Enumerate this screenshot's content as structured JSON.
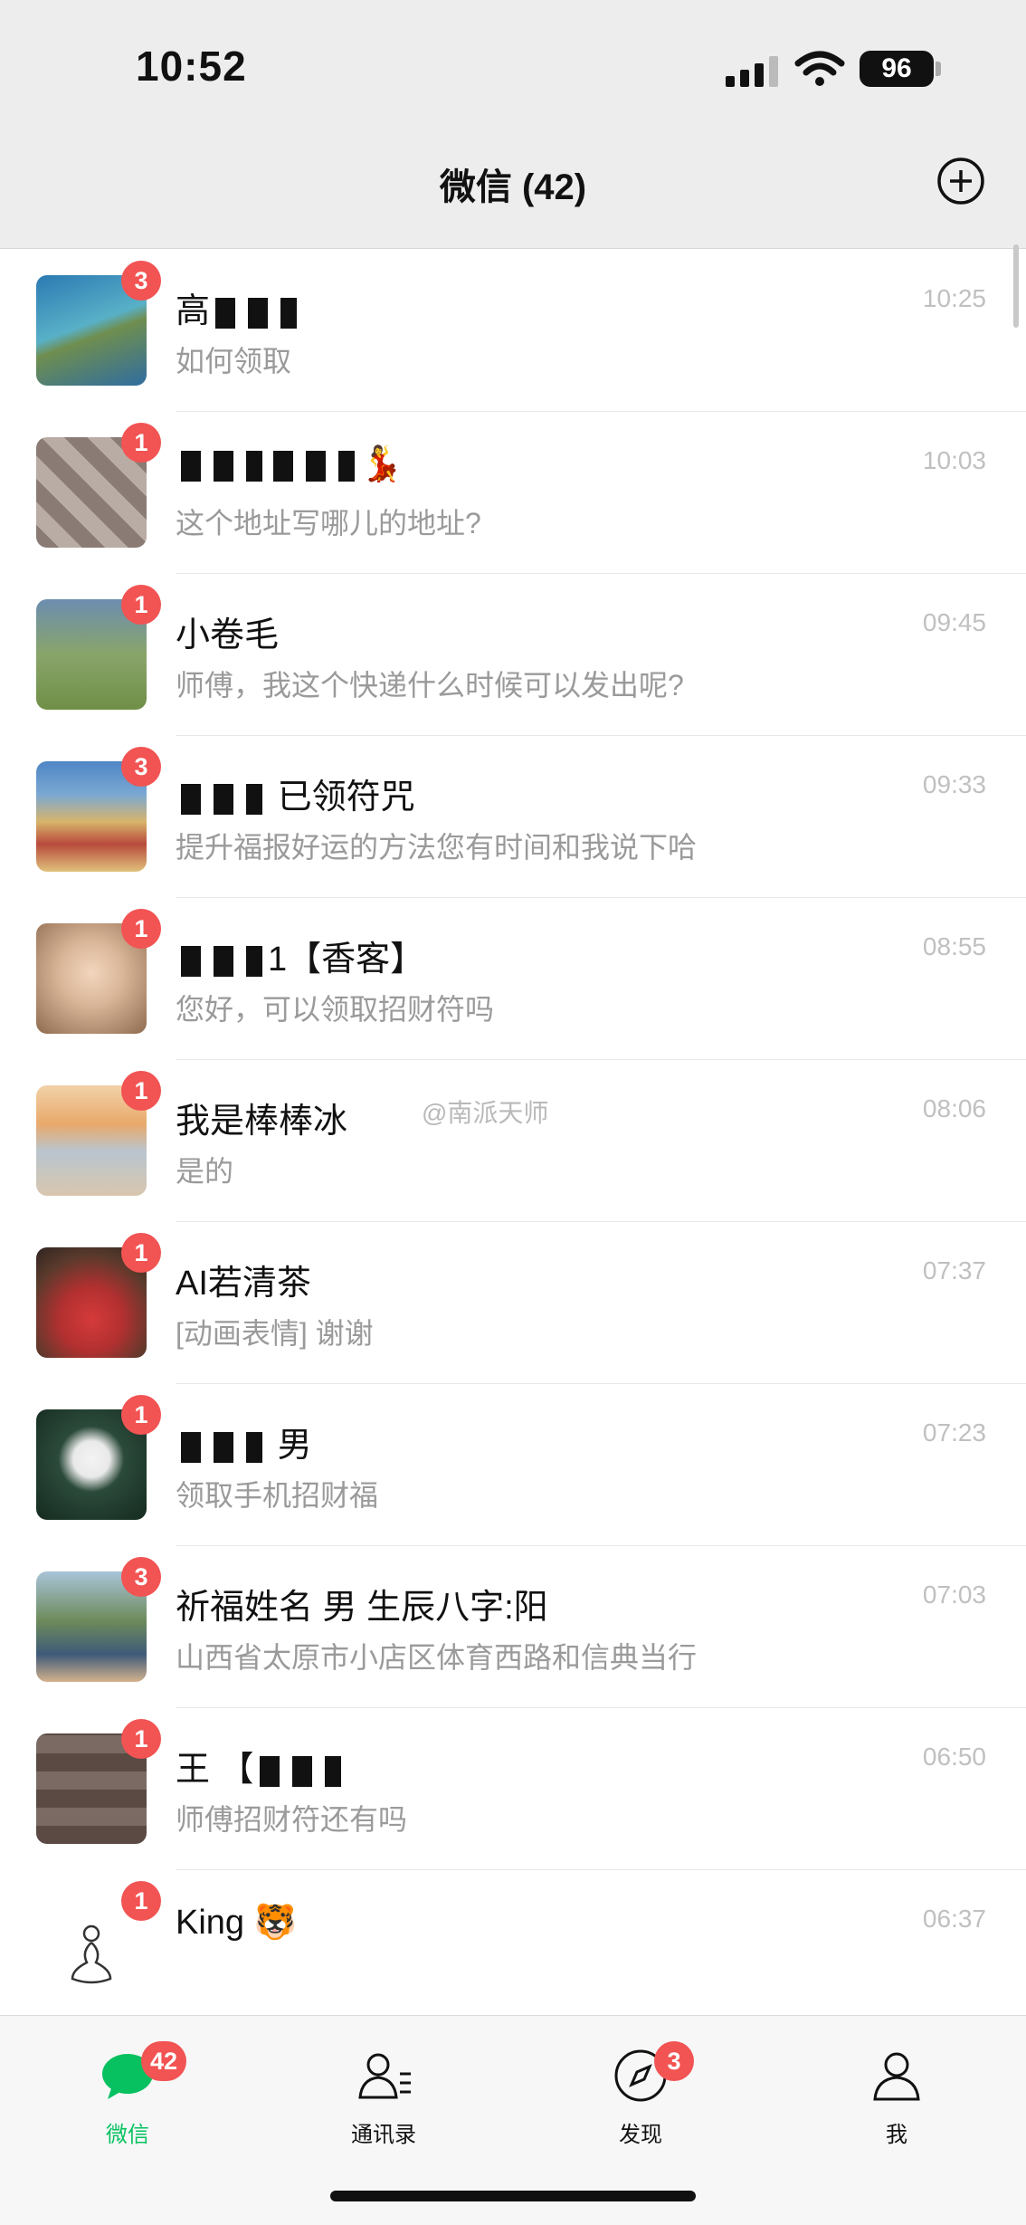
{
  "status_bar": {
    "time": "10:52",
    "battery": "96"
  },
  "nav": {
    "title": "微信 (42)"
  },
  "watermark": "@南派天师",
  "chats": [
    {
      "name": "高",
      "preview": "如何领取",
      "time": "10:25",
      "badge": "3",
      "avatar_color": "#3a8fb3"
    },
    {
      "name": "",
      "preview": "这个地址写哪儿的地址?",
      "time": "10:03",
      "badge": "1",
      "avatar_color": "#8a7c75"
    },
    {
      "name": "小卷毛",
      "preview": "师傅，我这个快递什么时候可以发出呢?",
      "time": "09:45",
      "badge": "1",
      "avatar_color": "#7d9a5d"
    },
    {
      "name": "已领符咒",
      "preview": "提升福报好运的方法您有时间和我说下哈",
      "time": "09:33",
      "badge": "3",
      "avatar_color": "#c89a56"
    },
    {
      "name": "1【香客】",
      "preview": "您好，可以领取招财符吗",
      "time": "08:55",
      "badge": "1",
      "avatar_color": "#d9b598"
    },
    {
      "name": "我是棒棒冰",
      "preview": "是的",
      "time": "08:06",
      "badge": "1",
      "avatar_color": "#e5c7a8"
    },
    {
      "name": "AI若清茶",
      "preview": "[动画表情] 谢谢",
      "time": "07:37",
      "badge": "1",
      "avatar_color": "#c73b3b"
    },
    {
      "name": "男",
      "preview": "领取手机招财福",
      "time": "07:23",
      "badge": "1",
      "avatar_color": "#2b4a3a"
    },
    {
      "name": "祈福姓名 男 生辰八字:阳",
      "preview": "山西省太原市小店区体育西路和信典当行",
      "time": "07:03",
      "badge": "3",
      "avatar_color": "#6d8a5b"
    },
    {
      "name": "王 【",
      "preview": "师傅招财符还有吗",
      "time": "06:50",
      "badge": "1",
      "avatar_color": "#5b4a44"
    },
    {
      "name": "King 🐯",
      "preview": "",
      "time": "06:37",
      "badge": "1",
      "avatar_color": "#ffffff"
    }
  ],
  "tabs": [
    {
      "label": "微信",
      "badge": "42"
    },
    {
      "label": "通讯录",
      "badge": ""
    },
    {
      "label": "发现",
      "badge": "3"
    },
    {
      "label": "我",
      "badge": ""
    }
  ],
  "colors": {
    "accent": "#07c160",
    "badge": "#f25353"
  }
}
